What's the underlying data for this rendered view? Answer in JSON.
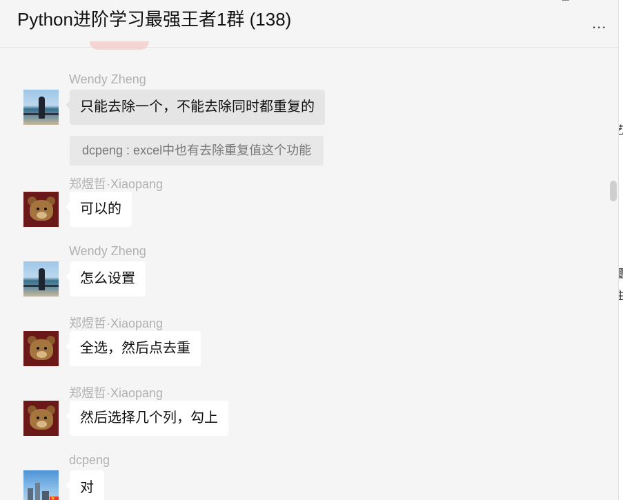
{
  "header": {
    "title": "Python进阶学习最强王者1群 (138)",
    "more_label": "...",
    "minimize_label": "–",
    "maximize_label": "□",
    "close_label": "×"
  },
  "messages": [
    {
      "sender": "Wendy  Zheng",
      "avatar": "wendy-avatar",
      "text": "只能去除一个，不能去除同时都重复的"
    },
    {
      "quote": "dcpeng : excel中也有去除重复值这个功能"
    },
    {
      "sender": "郑煜哲·Xiaopang",
      "avatar": "bear-avatar",
      "text": "可以的"
    },
    {
      "sender": "Wendy  Zheng",
      "avatar": "wendy-avatar",
      "text": "怎么设置"
    },
    {
      "sender": "郑煜哲·Xiaopang",
      "avatar": "bear-avatar",
      "text": "全选，然后点去重"
    },
    {
      "sender": "郑煜哲·Xiaopang",
      "avatar": "bear-avatar",
      "text": "然后选择几个列，勾上"
    },
    {
      "sender": "dcpeng",
      "avatar": "city-avatar",
      "text": "对"
    }
  ],
  "right_edge_glyphs": [
    "艺",
    "璽",
    "注"
  ],
  "colors": {
    "background": "#f5f5f5",
    "bubble_other": "#ffffff",
    "bubble_self_gray": "#e5e5e5",
    "sender_name": "#b1b1b1"
  }
}
